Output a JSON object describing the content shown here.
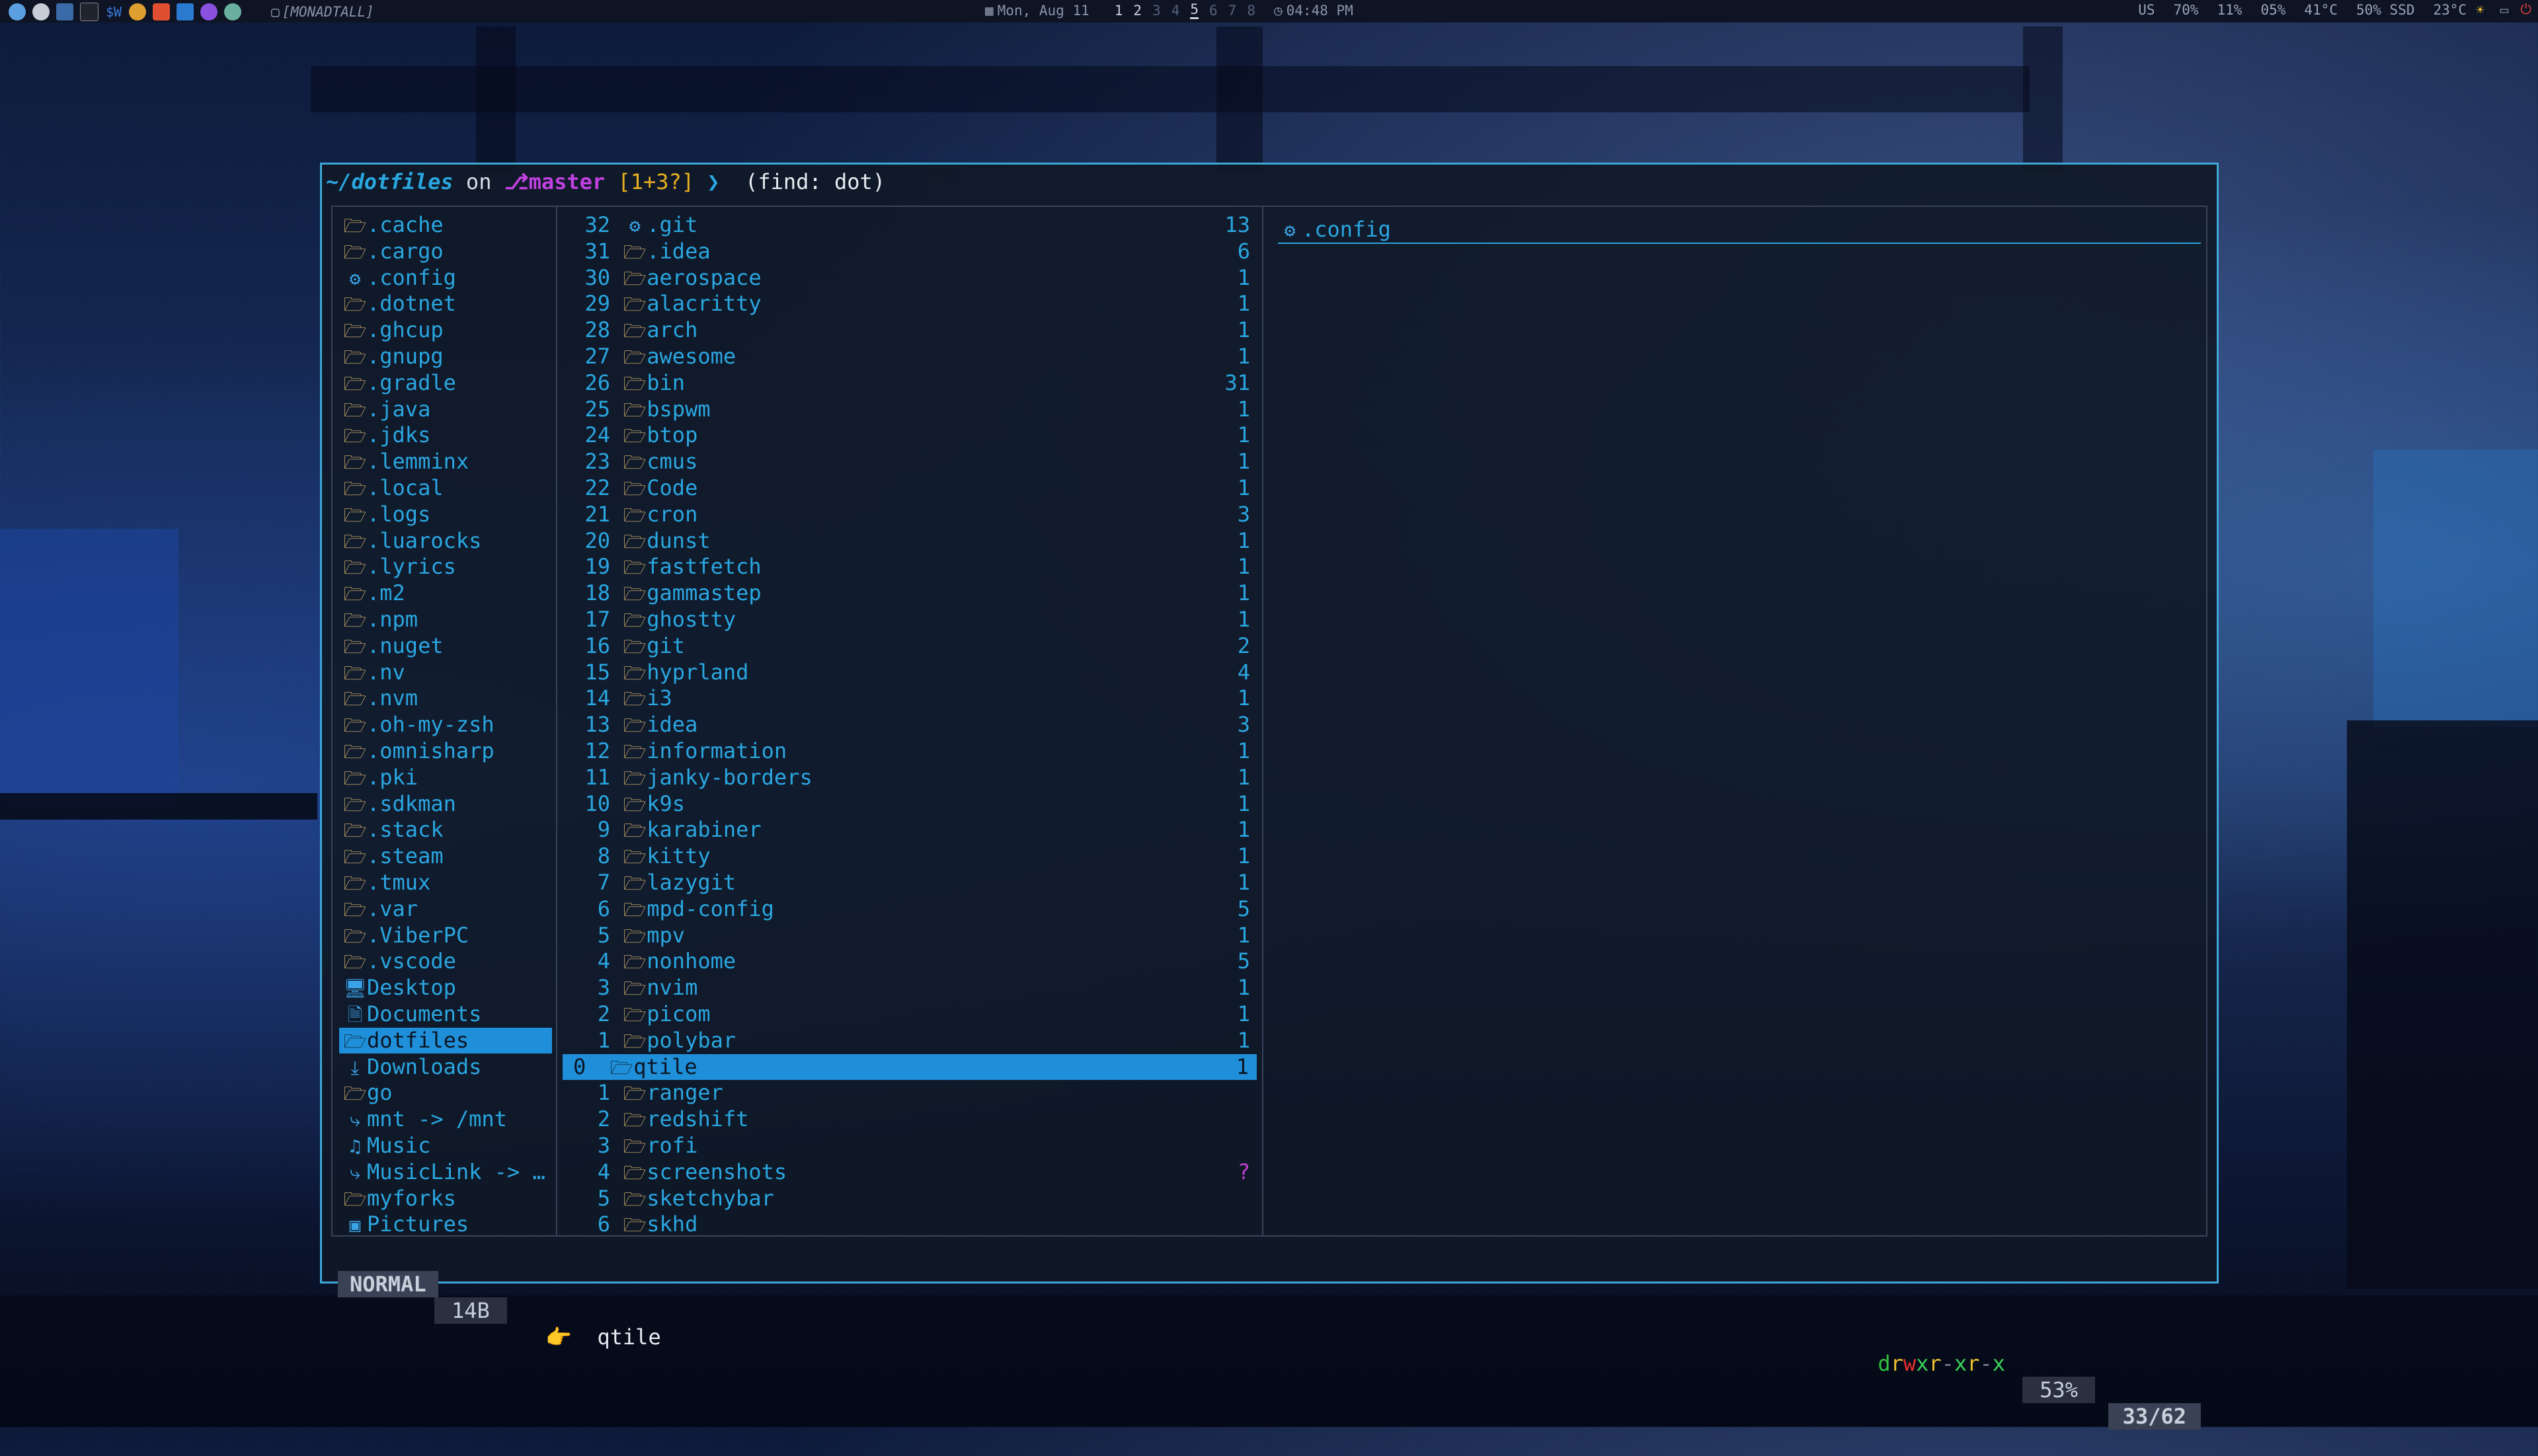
{
  "topbar": {
    "left_icons": [
      "qtile-icon",
      "gear-icon",
      "window-icon",
      "terminal-icon",
      "sw-icon",
      "pen-icon",
      "brave-icon",
      "vscode-icon",
      "browser-icon",
      "whatsapp-icon"
    ],
    "sw_label": "$W",
    "layout_label": "[MONADTALL]",
    "date": "Mon, Aug 11",
    "workspaces": [
      "1",
      "2",
      "3",
      "4",
      "5",
      "6",
      "7",
      "8"
    ],
    "active_workspace": "5",
    "time": "04:48 PM",
    "status": [
      "US",
      "70%",
      "11%",
      "05%",
      "41°C",
      "50% SSD",
      "23°C"
    ]
  },
  "prompt": {
    "path": "~/dotfiles",
    "on": "on",
    "branch_icon": "git-branch-icon",
    "branch": "master",
    "git_status": "[1+3?]",
    "arrow": "❯",
    "find": "(find: dot)"
  },
  "parent_pane": [
    {
      "icon": "folder",
      "name": ".cache"
    },
    {
      "icon": "folder",
      "name": ".cargo"
    },
    {
      "icon": "config",
      "name": ".config"
    },
    {
      "icon": "folder",
      "name": ".dotnet"
    },
    {
      "icon": "folder",
      "name": ".ghcup"
    },
    {
      "icon": "folder",
      "name": ".gnupg"
    },
    {
      "icon": "folder",
      "name": ".gradle"
    },
    {
      "icon": "folder",
      "name": ".java"
    },
    {
      "icon": "folder",
      "name": ".jdks"
    },
    {
      "icon": "folder",
      "name": ".lemminx"
    },
    {
      "icon": "folder",
      "name": ".local"
    },
    {
      "icon": "folder",
      "name": ".logs"
    },
    {
      "icon": "folder",
      "name": ".luarocks"
    },
    {
      "icon": "folder",
      "name": ".lyrics"
    },
    {
      "icon": "folder",
      "name": ".m2"
    },
    {
      "icon": "folder",
      "name": ".npm"
    },
    {
      "icon": "folder",
      "name": ".nuget"
    },
    {
      "icon": "folder",
      "name": ".nv"
    },
    {
      "icon": "folder",
      "name": ".nvm"
    },
    {
      "icon": "folder",
      "name": ".oh-my-zsh"
    },
    {
      "icon": "folder",
      "name": ".omnisharp"
    },
    {
      "icon": "folder",
      "name": ".pki"
    },
    {
      "icon": "folder",
      "name": ".sdkman"
    },
    {
      "icon": "folder",
      "name": ".stack"
    },
    {
      "icon": "folder",
      "name": ".steam"
    },
    {
      "icon": "folder",
      "name": ".tmux"
    },
    {
      "icon": "folder",
      "name": ".var"
    },
    {
      "icon": "folder",
      "name": ".ViberPC"
    },
    {
      "icon": "folder",
      "name": ".vscode"
    },
    {
      "icon": "desktop",
      "name": "Desktop"
    },
    {
      "icon": "document",
      "name": "Documents"
    },
    {
      "icon": "folder",
      "name": "dotfiles",
      "selected": true
    },
    {
      "icon": "download",
      "name": "Downloads"
    },
    {
      "icon": "folder",
      "name": "go"
    },
    {
      "icon": "link",
      "name": "mnt -> /mnt"
    },
    {
      "icon": "music",
      "name": "Music"
    },
    {
      "icon": "link",
      "name": "MusicLink -> …"
    },
    {
      "icon": "folder",
      "name": "myforks"
    },
    {
      "icon": "picture",
      "name": "Pictures"
    }
  ],
  "current_pane": [
    {
      "num": "32",
      "icon": "config",
      "name": ".git",
      "count": "13"
    },
    {
      "num": "31",
      "icon": "folder",
      "name": ".idea",
      "count": "6"
    },
    {
      "num": "30",
      "icon": "folder",
      "name": "aerospace",
      "count": "1"
    },
    {
      "num": "29",
      "icon": "folder",
      "name": "alacritty",
      "count": "1"
    },
    {
      "num": "28",
      "icon": "folder",
      "name": "arch",
      "count": "1"
    },
    {
      "num": "27",
      "icon": "folder",
      "name": "awesome",
      "count": "1"
    },
    {
      "num": "26",
      "icon": "folder",
      "name": "bin",
      "count": "31"
    },
    {
      "num": "25",
      "icon": "folder",
      "name": "bspwm",
      "count": "1"
    },
    {
      "num": "24",
      "icon": "folder",
      "name": "btop",
      "count": "1"
    },
    {
      "num": "23",
      "icon": "folder",
      "name": "cmus",
      "count": "1"
    },
    {
      "num": "22",
      "icon": "folder",
      "name": "Code",
      "count": "1"
    },
    {
      "num": "21",
      "icon": "folder",
      "name": "cron",
      "count": "3"
    },
    {
      "num": "20",
      "icon": "folder",
      "name": "dunst",
      "count": "1"
    },
    {
      "num": "19",
      "icon": "folder",
      "name": "fastfetch",
      "count": "1"
    },
    {
      "num": "18",
      "icon": "folder",
      "name": "gammastep",
      "count": "1"
    },
    {
      "num": "17",
      "icon": "folder",
      "name": "ghostty",
      "count": "1"
    },
    {
      "num": "16",
      "icon": "folder",
      "name": "git",
      "count": "2"
    },
    {
      "num": "15",
      "icon": "folder",
      "name": "hyprland",
      "count": "4"
    },
    {
      "num": "14",
      "icon": "folder",
      "name": "i3",
      "count": "1"
    },
    {
      "num": "13",
      "icon": "folder",
      "name": "idea",
      "count": "3"
    },
    {
      "num": "12",
      "icon": "folder",
      "name": "information",
      "count": "1"
    },
    {
      "num": "11",
      "icon": "folder",
      "name": "janky-borders",
      "count": "1"
    },
    {
      "num": "10",
      "icon": "folder",
      "name": "k9s",
      "count": "1"
    },
    {
      "num": "9",
      "icon": "folder",
      "name": "karabiner",
      "count": "1"
    },
    {
      "num": "8",
      "icon": "folder",
      "name": "kitty",
      "count": "1"
    },
    {
      "num": "7",
      "icon": "folder",
      "name": "lazygit",
      "count": "1"
    },
    {
      "num": "6",
      "icon": "folder",
      "name": "mpd-config",
      "count": "5"
    },
    {
      "num": "5",
      "icon": "folder",
      "name": "mpv",
      "count": "1"
    },
    {
      "num": "4",
      "icon": "folder",
      "name": "nonhome",
      "count": "5"
    },
    {
      "num": "3",
      "icon": "folder",
      "name": "nvim",
      "count": "1"
    },
    {
      "num": "2",
      "icon": "folder",
      "name": "picom",
      "count": "1"
    },
    {
      "num": "1",
      "icon": "folder",
      "name": "polybar",
      "count": "1"
    },
    {
      "num": "0",
      "icon": "folder",
      "name": "qtile",
      "count": "1",
      "selected": true
    },
    {
      "num": "1",
      "icon": "folder",
      "name": "ranger",
      "count": ""
    },
    {
      "num": "2",
      "icon": "folder",
      "name": "redshift",
      "count": ""
    },
    {
      "num": "3",
      "icon": "folder",
      "name": "rofi",
      "count": ""
    },
    {
      "num": "4",
      "icon": "folder",
      "name": "screenshots",
      "count": "?"
    },
    {
      "num": "5",
      "icon": "folder",
      "name": "sketchybar",
      "count": ""
    },
    {
      "num": "6",
      "icon": "folder",
      "name": "skhd",
      "count": ""
    }
  ],
  "preview_pane": {
    "icon": "config",
    "name": ".config"
  },
  "statusbar": {
    "mode": "NORMAL",
    "size": "14B",
    "current_icon": "👉",
    "current": "qtile",
    "permissions": "drwxr-xr-x",
    "percent": "53%",
    "position": "33/62"
  },
  "colors": {
    "accent": "#2aa6e0",
    "selection": "#1e8fd8",
    "branch": "#c040e0",
    "git_status": "#e8b020",
    "folder": "#e8c070"
  }
}
